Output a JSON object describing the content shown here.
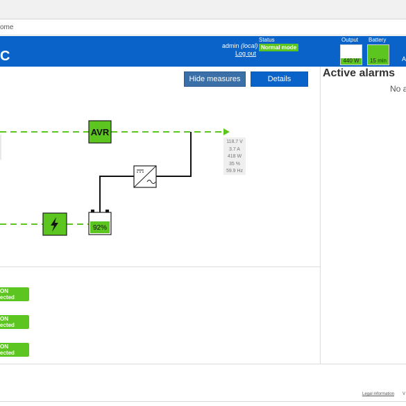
{
  "breadcrumb": {
    "text": "ome"
  },
  "header": {
    "brand_fragment": "C",
    "user_name": "admin",
    "user_scope": "(local)",
    "logout_label": "Log out",
    "status_label": "Status",
    "status_value": "Normal mode",
    "output_label": "Output",
    "output_value": "440 W",
    "battery_label": "Battery",
    "battery_value": "15 min",
    "cut_text": "A",
    "colors": {
      "bar": "#0a63c9",
      "ok": "#5cc51f"
    }
  },
  "toolbar": {
    "hide_measures_label": "Hide measures",
    "details_label": "Details"
  },
  "diagram": {
    "avr_label": "AVR",
    "battery_percent": "92%",
    "measures": [
      "118.7 V",
      "3.7 A",
      "418 W",
      "35 %",
      "59.9 Hz"
    ]
  },
  "outlets": [
    {
      "line1": "ON",
      "line2": "ected"
    },
    {
      "line1": "ON",
      "line2": "ected"
    },
    {
      "line1": "ON",
      "line2": "ected"
    }
  ],
  "alarms": {
    "title": "Active alarms",
    "empty_text": "No a"
  },
  "footer": {
    "legal_label": "Legal information",
    "cut_text": "V"
  }
}
